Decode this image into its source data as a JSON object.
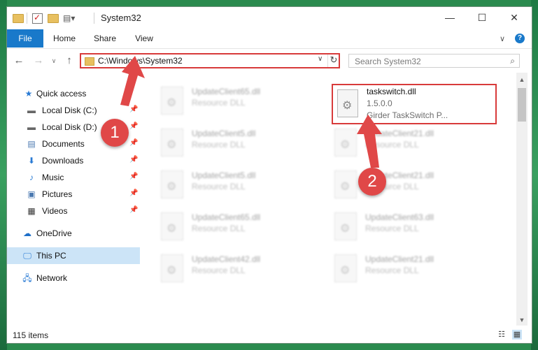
{
  "window": {
    "title": "System32"
  },
  "ribbon": {
    "tabs": [
      "File",
      "Home",
      "Share",
      "View"
    ],
    "help": "?"
  },
  "caption": {
    "minimize": "—",
    "maximize": "☐",
    "close": "✕",
    "expand": "∨"
  },
  "address": {
    "path": "C:\\Windows\\System32"
  },
  "search": {
    "placeholder": "Search System32"
  },
  "sidebar": {
    "items": [
      {
        "label": "Quick access",
        "icon": "star-icon"
      },
      {
        "label": "Local Disk (C:)",
        "icon": "drive-icon",
        "pinned": true
      },
      {
        "label": "Local Disk (D:)",
        "icon": "drive-icon",
        "pinned": true
      },
      {
        "label": "Documents",
        "icon": "document-icon",
        "pinned": true
      },
      {
        "label": "Downloads",
        "icon": "download-icon",
        "pinned": true
      },
      {
        "label": "Music",
        "icon": "music-icon",
        "pinned": true
      },
      {
        "label": "Pictures",
        "icon": "picture-icon",
        "pinned": true
      },
      {
        "label": "Videos",
        "icon": "video-icon",
        "pinned": true
      },
      {
        "label": "OneDrive",
        "icon": "cloud-icon"
      },
      {
        "label": "This PC",
        "icon": "computer-icon",
        "selected": true
      },
      {
        "label": "Network",
        "icon": "network-icon"
      }
    ]
  },
  "files": {
    "left": [
      {
        "name": "UpdateClient65.dll",
        "type": "Resource DLL"
      },
      {
        "name": "UpdateClient5.dll",
        "type": "Resource DLL"
      },
      {
        "name": "UpdateClient5.dll",
        "type": "Resource DLL"
      },
      {
        "name": "UpdateClient65.dll",
        "type": "Resource DLL"
      },
      {
        "name": "UpdateClient42.dll",
        "type": "Resource DLL"
      }
    ],
    "right": [
      {
        "name": "UpdateClient21.dll",
        "type": "Resource DLL"
      },
      {
        "name": "UpdateClient21.dll",
        "type": "Resource DLL"
      },
      {
        "name": "UpdateClient63.dll",
        "type": "Resource DLL"
      },
      {
        "name": "UpdateClient21.dll",
        "type": "Resource DLL"
      }
    ],
    "selected": {
      "name": "taskswitch.dll",
      "version": "1.5.0.0",
      "company": "Girder TaskSwitch P..."
    }
  },
  "status": {
    "count": "115 items"
  },
  "markers": [
    "1",
    "2"
  ],
  "colors": {
    "accent": "#1979ca",
    "annotation": "#d83a3a"
  }
}
